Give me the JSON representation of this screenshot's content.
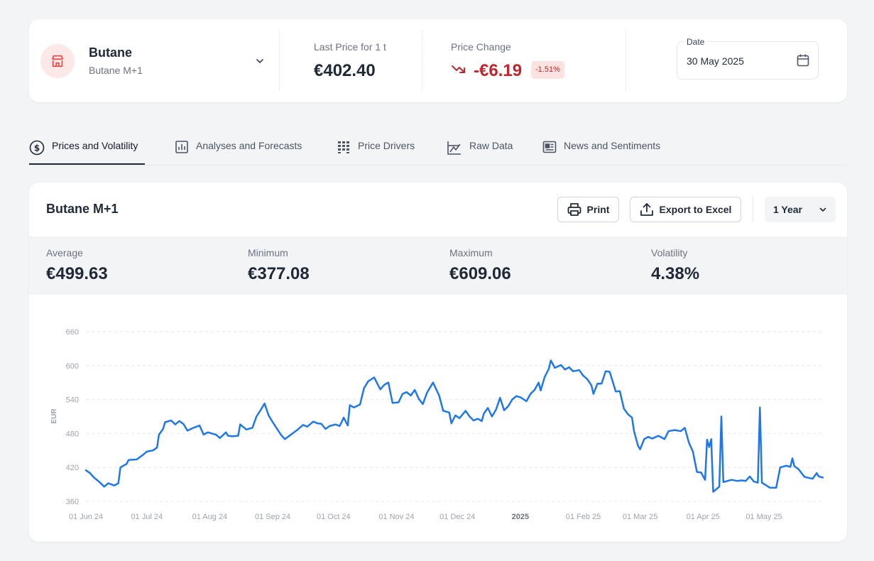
{
  "product": {
    "name": "Butane",
    "contract": "Butane M+1",
    "last_price_label": "Last Price for 1 t",
    "last_price": "€402.40",
    "price_change_label": "Price Change",
    "price_change": "-€6.19",
    "price_change_pct": "-1.51%",
    "date_label": "Date",
    "date_value": "30 May 2025"
  },
  "tabs": [
    {
      "label": "Prices and Volatility",
      "icon": "dollar-circle-icon",
      "active": true
    },
    {
      "label": "Analyses and Forecasts",
      "icon": "bar-chart-icon",
      "active": false
    },
    {
      "label": "Price Drivers",
      "icon": "grid-dots-icon",
      "active": false
    },
    {
      "label": "Raw Data",
      "icon": "chart-line-icon",
      "active": false
    },
    {
      "label": "News and Sentiments",
      "icon": "newspaper-icon",
      "active": false
    }
  ],
  "card": {
    "title": "Butane M+1",
    "print_label": "Print",
    "export_label": "Export to Excel",
    "range_label": "1 Year"
  },
  "stats": [
    {
      "label": "Average",
      "value": "€499.63"
    },
    {
      "label": "Minimum",
      "value": "€377.08"
    },
    {
      "label": "Maximum",
      "value": "€609.06"
    },
    {
      "label": "Volatility",
      "value": "4.38%"
    }
  ],
  "colors": {
    "line": "#1f77e8",
    "negative": "#c0262d",
    "icon_bg": "#fde8e8",
    "icon_fg": "#ef4444"
  },
  "chart_data": {
    "type": "line",
    "ylabel": "EUR",
    "ylim": [
      360,
      660
    ],
    "yticks": [
      360,
      420,
      480,
      540,
      600,
      660
    ],
    "xticks": [
      {
        "date": "2024-06-01",
        "label": "01 Jun 24"
      },
      {
        "date": "2024-07-01",
        "label": "01 Jul 24"
      },
      {
        "date": "2024-08-01",
        "label": "01 Aug 24"
      },
      {
        "date": "2024-09-01",
        "label": "01 Sep 24"
      },
      {
        "date": "2024-10-01",
        "label": "01 Oct 24"
      },
      {
        "date": "2024-11-01",
        "label": "01 Nov 24"
      },
      {
        "date": "2024-12-01",
        "label": "01 Dec 24"
      },
      {
        "date": "2025-01-01",
        "label": "2025"
      },
      {
        "date": "2025-02-01",
        "label": "01 Feb 25"
      },
      {
        "date": "2025-03-01",
        "label": "01 Mar 25"
      },
      {
        "date": "2025-04-01",
        "label": "01 Apr 25"
      },
      {
        "date": "2025-05-01",
        "label": "01 May 25"
      }
    ],
    "grid": true,
    "series": [
      {
        "values": [
          [
            "2024-06-01",
            415
          ],
          [
            "2024-06-03",
            410
          ],
          [
            "2024-06-05",
            402
          ],
          [
            "2024-06-08",
            393
          ],
          [
            "2024-06-10",
            386
          ],
          [
            "2024-06-12",
            392
          ],
          [
            "2024-06-15",
            388
          ],
          [
            "2024-06-17",
            392
          ],
          [
            "2024-06-18",
            420
          ],
          [
            "2024-06-21",
            426
          ],
          [
            "2024-06-22",
            433
          ],
          [
            "2024-06-26",
            434
          ],
          [
            "2024-06-29",
            442
          ],
          [
            "2024-07-01",
            448
          ],
          [
            "2024-07-04",
            450
          ],
          [
            "2024-07-06",
            455
          ],
          [
            "2024-07-07",
            478
          ],
          [
            "2024-07-09",
            488
          ],
          [
            "2024-07-10",
            500
          ],
          [
            "2024-07-13",
            503
          ],
          [
            "2024-07-15",
            496
          ],
          [
            "2024-07-17",
            502
          ],
          [
            "2024-07-19",
            497
          ],
          [
            "2024-07-21",
            485
          ],
          [
            "2024-07-24",
            490
          ],
          [
            "2024-07-27",
            494
          ],
          [
            "2024-07-29",
            478
          ],
          [
            "2024-07-31",
            482
          ],
          [
            "2024-08-02",
            480
          ],
          [
            "2024-08-04",
            478
          ],
          [
            "2024-08-06",
            472
          ],
          [
            "2024-08-09",
            482
          ],
          [
            "2024-08-10",
            476
          ],
          [
            "2024-08-12",
            475
          ],
          [
            "2024-08-15",
            476
          ],
          [
            "2024-08-16",
            496
          ],
          [
            "2024-08-19",
            487
          ],
          [
            "2024-08-22",
            490
          ],
          [
            "2024-08-24",
            510
          ],
          [
            "2024-08-26",
            521
          ],
          [
            "2024-08-28",
            533
          ],
          [
            "2024-08-30",
            512
          ],
          [
            "2024-09-01",
            500
          ],
          [
            "2024-09-03",
            489
          ],
          [
            "2024-09-05",
            478
          ],
          [
            "2024-09-07",
            470
          ],
          [
            "2024-09-10",
            478
          ],
          [
            "2024-09-13",
            486
          ],
          [
            "2024-09-16",
            495
          ],
          [
            "2024-09-18",
            492
          ],
          [
            "2024-09-21",
            501
          ],
          [
            "2024-09-23",
            498
          ],
          [
            "2024-09-25",
            497
          ],
          [
            "2024-09-27",
            488
          ],
          [
            "2024-09-29",
            493
          ],
          [
            "2024-10-02",
            496
          ],
          [
            "2024-10-04",
            493
          ],
          [
            "2024-10-06",
            508
          ],
          [
            "2024-10-08",
            494
          ],
          [
            "2024-10-09",
            530
          ],
          [
            "2024-10-11",
            526
          ],
          [
            "2024-10-14",
            531
          ],
          [
            "2024-10-16",
            560
          ],
          [
            "2024-10-18",
            572
          ],
          [
            "2024-10-21",
            579
          ],
          [
            "2024-10-24",
            558
          ],
          [
            "2024-10-26",
            566
          ],
          [
            "2024-10-28",
            570
          ],
          [
            "2024-10-30",
            534
          ],
          [
            "2024-11-02",
            535
          ],
          [
            "2024-11-04",
            550
          ],
          [
            "2024-11-06",
            553
          ],
          [
            "2024-11-08",
            547
          ],
          [
            "2024-11-10",
            557
          ],
          [
            "2024-11-12",
            541
          ],
          [
            "2024-11-14",
            532
          ],
          [
            "2024-11-16",
            552
          ],
          [
            "2024-11-19",
            570
          ],
          [
            "2024-11-22",
            547
          ],
          [
            "2024-11-24",
            520
          ],
          [
            "2024-11-27",
            517
          ],
          [
            "2024-11-28",
            498
          ],
          [
            "2024-11-30",
            512
          ],
          [
            "2024-12-02",
            507
          ],
          [
            "2024-12-05",
            520
          ],
          [
            "2024-12-07",
            510
          ],
          [
            "2024-12-09",
            503
          ],
          [
            "2024-12-11",
            506
          ],
          [
            "2024-12-13",
            502
          ],
          [
            "2024-12-14",
            515
          ],
          [
            "2024-12-16",
            525
          ],
          [
            "2024-12-18",
            510
          ],
          [
            "2024-12-20",
            522
          ],
          [
            "2024-12-22",
            543
          ],
          [
            "2024-12-24",
            521
          ],
          [
            "2024-12-26",
            528
          ],
          [
            "2024-12-28",
            540
          ],
          [
            "2024-12-30",
            546
          ],
          [
            "2025-01-01",
            544
          ],
          [
            "2025-01-04",
            537
          ],
          [
            "2025-01-06",
            550
          ],
          [
            "2025-01-08",
            557
          ],
          [
            "2025-01-10",
            570
          ],
          [
            "2025-01-11",
            556
          ],
          [
            "2025-01-13",
            580
          ],
          [
            "2025-01-15",
            594
          ],
          [
            "2025-01-16",
            609
          ],
          [
            "2025-01-18",
            596
          ],
          [
            "2025-01-21",
            601
          ],
          [
            "2025-01-23",
            593
          ],
          [
            "2025-01-25",
            597
          ],
          [
            "2025-01-27",
            590
          ],
          [
            "2025-01-30",
            592
          ],
          [
            "2025-02-01",
            582
          ],
          [
            "2025-02-03",
            576
          ],
          [
            "2025-02-05",
            565
          ],
          [
            "2025-02-06",
            550
          ],
          [
            "2025-02-08",
            568
          ],
          [
            "2025-02-10",
            568
          ],
          [
            "2025-02-12",
            590
          ],
          [
            "2025-02-14",
            589
          ],
          [
            "2025-02-17",
            554
          ],
          [
            "2025-02-19",
            555
          ],
          [
            "2025-02-21",
            524
          ],
          [
            "2025-02-23",
            514
          ],
          [
            "2025-02-25",
            508
          ],
          [
            "2025-02-26",
            484
          ],
          [
            "2025-02-28",
            458
          ],
          [
            "2025-03-01",
            452
          ],
          [
            "2025-03-03",
            470
          ],
          [
            "2025-03-05",
            474
          ],
          [
            "2025-03-07",
            471
          ],
          [
            "2025-03-10",
            476
          ],
          [
            "2025-03-13",
            470
          ],
          [
            "2025-03-15",
            484
          ],
          [
            "2025-03-18",
            486
          ],
          [
            "2025-03-21",
            484
          ],
          [
            "2025-03-23",
            490
          ],
          [
            "2025-03-25",
            464
          ],
          [
            "2025-03-27",
            448
          ],
          [
            "2025-03-29",
            412
          ],
          [
            "2025-03-31",
            411
          ],
          [
            "2025-04-02",
            398
          ],
          [
            "2025-04-03",
            469
          ],
          [
            "2025-04-04",
            456
          ],
          [
            "2025-04-05",
            470
          ],
          [
            "2025-04-06",
            377
          ],
          [
            "2025-04-09",
            386
          ],
          [
            "2025-04-10",
            510
          ],
          [
            "2025-04-11",
            394
          ],
          [
            "2025-04-15",
            398
          ],
          [
            "2025-04-18",
            396
          ],
          [
            "2025-04-20",
            397
          ],
          [
            "2025-04-22",
            396
          ],
          [
            "2025-04-24",
            404
          ],
          [
            "2025-04-26",
            395
          ],
          [
            "2025-04-28",
            393
          ],
          [
            "2025-04-29",
            526
          ],
          [
            "2025-04-30",
            393
          ],
          [
            "2025-05-04",
            384
          ],
          [
            "2025-05-07",
            384
          ],
          [
            "2025-05-09",
            420
          ],
          [
            "2025-05-12",
            423
          ],
          [
            "2025-05-14",
            421
          ],
          [
            "2025-05-15",
            436
          ],
          [
            "2025-05-16",
            422
          ],
          [
            "2025-05-18",
            417
          ],
          [
            "2025-05-21",
            403
          ],
          [
            "2025-05-25",
            400
          ],
          [
            "2025-05-27",
            410
          ],
          [
            "2025-05-28",
            404
          ],
          [
            "2025-05-30",
            402
          ]
        ]
      }
    ]
  }
}
